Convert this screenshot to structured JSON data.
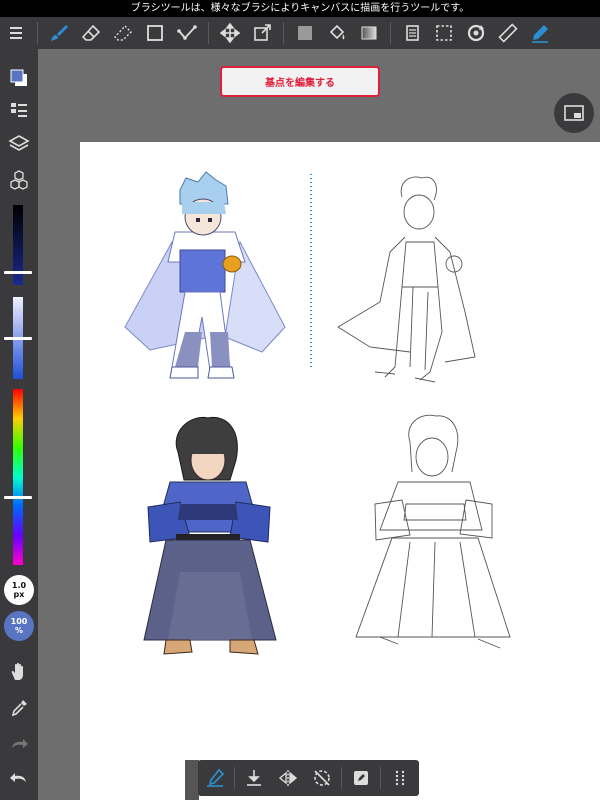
{
  "tip": {
    "text": "ブラシツールは、様々なブラシによりキャンバスに描画を行うツールです。"
  },
  "canvas": {
    "edit_base_button": "基点を編集する"
  },
  "sidebar": {
    "brush_size": "1.0",
    "brush_size_unit": "px",
    "opacity": "100",
    "opacity_unit": "%"
  },
  "colors": {
    "accent": "#2b8fd6",
    "toolbar_bg": "#3a3a3c",
    "canvas_bg": "#6e6e6e",
    "base_button_red": "#e0203a",
    "opacity_circle": "#5a74c4"
  }
}
